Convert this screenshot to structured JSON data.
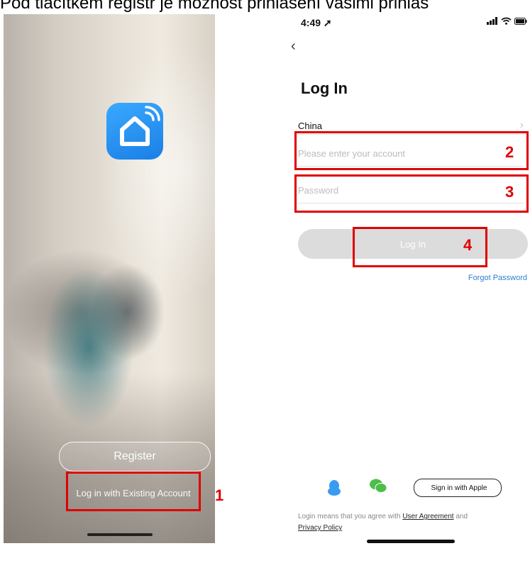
{
  "caption": "Pod tlačítkem registr je možnost přihlášení vašimi přihlaš",
  "left_screen": {
    "register_label": "Register",
    "existing_account_label": "Log in with Existing Account"
  },
  "right_screen": {
    "status_time": "4:49",
    "title": "Log In",
    "country": "China",
    "account_placeholder": "Please enter your account",
    "password_placeholder": "Password",
    "login_button_label": "Log In",
    "forgot_password": "Forgot Password",
    "apple_signin_label": "Sign in with Apple",
    "legal_prefix": "Login means that you agree with",
    "user_agreement": "User Agreement",
    "legal_and": "and",
    "privacy_policy": "Privacy Policy"
  },
  "annotations": [
    "1",
    "2",
    "3",
    "4"
  ],
  "colors": {
    "annotation": "#e00000",
    "link": "#2f7fd6",
    "app_icon": "#1a7fe6",
    "login_button": "#dcdcdc"
  },
  "icons": [
    "app-home-wifi-icon",
    "back-chevron-icon",
    "qq-icon",
    "wechat-icon",
    "apple-icon",
    "signal-icon",
    "wifi-icon",
    "battery-icon"
  ]
}
